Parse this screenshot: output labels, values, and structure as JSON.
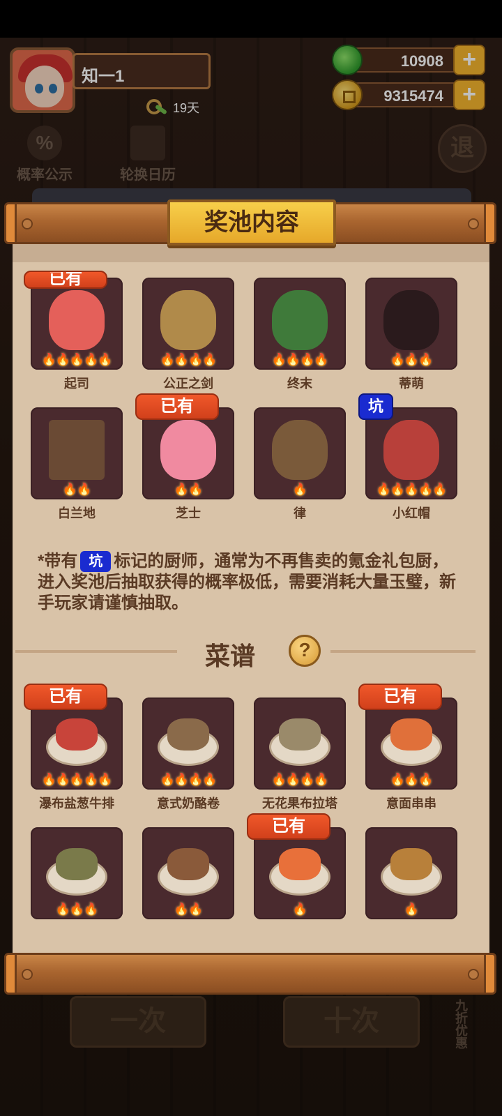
{
  "header": {
    "player_name": "知一1",
    "days": "19天",
    "jade_amount": "10908",
    "gold_amount": "9315474",
    "plus": "+"
  },
  "background": {
    "btn_probability": "概率公示",
    "btn_calendar": "轮换日历",
    "probability_icon": "%",
    "exit_label": "退",
    "single_draw": "一次",
    "ten_draw": "十次",
    "discount": "九折优惠"
  },
  "modal": {
    "title": "奖池内容",
    "owned_label": "已有",
    "pit_label": "坑",
    "chefs": [
      {
        "name": "起司",
        "stars": "🔥🔥🔥🔥🔥",
        "owned": true,
        "pit": false,
        "art_color": "#e4605a"
      },
      {
        "name": "公正之剑",
        "stars": "🔥🔥🔥🔥",
        "owned": false,
        "pit": false,
        "art_color": "#b08a4a"
      },
      {
        "name": "终末",
        "stars": "🔥🔥🔥🔥",
        "owned": false,
        "pit": false,
        "art_color": "#3f7a3a"
      },
      {
        "name": "蒂萌",
        "stars": "🔥🔥🔥",
        "owned": false,
        "pit": false,
        "art_color": "#2a1a1c"
      },
      {
        "name": "白兰地",
        "stars": "🔥🔥",
        "owned": false,
        "pit": false,
        "art_color": "#6a4a34"
      },
      {
        "name": "芝士",
        "stars": "🔥🔥",
        "owned": true,
        "pit": false,
        "art_color": "#f08aa0"
      },
      {
        "name": "律",
        "stars": "🔥",
        "owned": false,
        "pit": false,
        "art_color": "#7a5a3a"
      },
      {
        "name": "小红帽",
        "stars": "🔥🔥🔥🔥🔥",
        "owned": false,
        "pit": true,
        "art_color": "#b8403a"
      }
    ],
    "notice_prefix": "*带有",
    "notice_suffix": "标记的厨师，通常为不再售卖的氪金礼包厨，进入奖池后抽取获得的概率极低，需要消耗大量玉璧，新手玩家请谨慎抽取。",
    "recipes_title": "菜谱",
    "help_icon": "?",
    "recipes": [
      {
        "name": "瀑布盐葱牛排",
        "stars": "🔥🔥🔥🔥🔥",
        "owned": true,
        "food_color": "#c8443a"
      },
      {
        "name": "意式奶酪卷",
        "stars": "🔥🔥🔥🔥",
        "owned": false,
        "food_color": "#8a6a4a"
      },
      {
        "name": "无花果布拉塔",
        "stars": "🔥🔥🔥🔥",
        "owned": false,
        "food_color": "#9a8a6a"
      },
      {
        "name": "意面串串",
        "stars": "🔥🔥🔥",
        "owned": true,
        "food_color": "#e0703a"
      },
      {
        "name": "",
        "stars": "🔥🔥🔥",
        "owned": false,
        "food_color": "#7a7a4a"
      },
      {
        "name": "",
        "stars": "🔥🔥",
        "owned": false,
        "food_color": "#8a5a3a"
      },
      {
        "name": "",
        "stars": "🔥",
        "owned": true,
        "food_color": "#e8703a"
      },
      {
        "name": "",
        "stars": "🔥",
        "owned": false,
        "food_color": "#b8803a"
      }
    ]
  }
}
